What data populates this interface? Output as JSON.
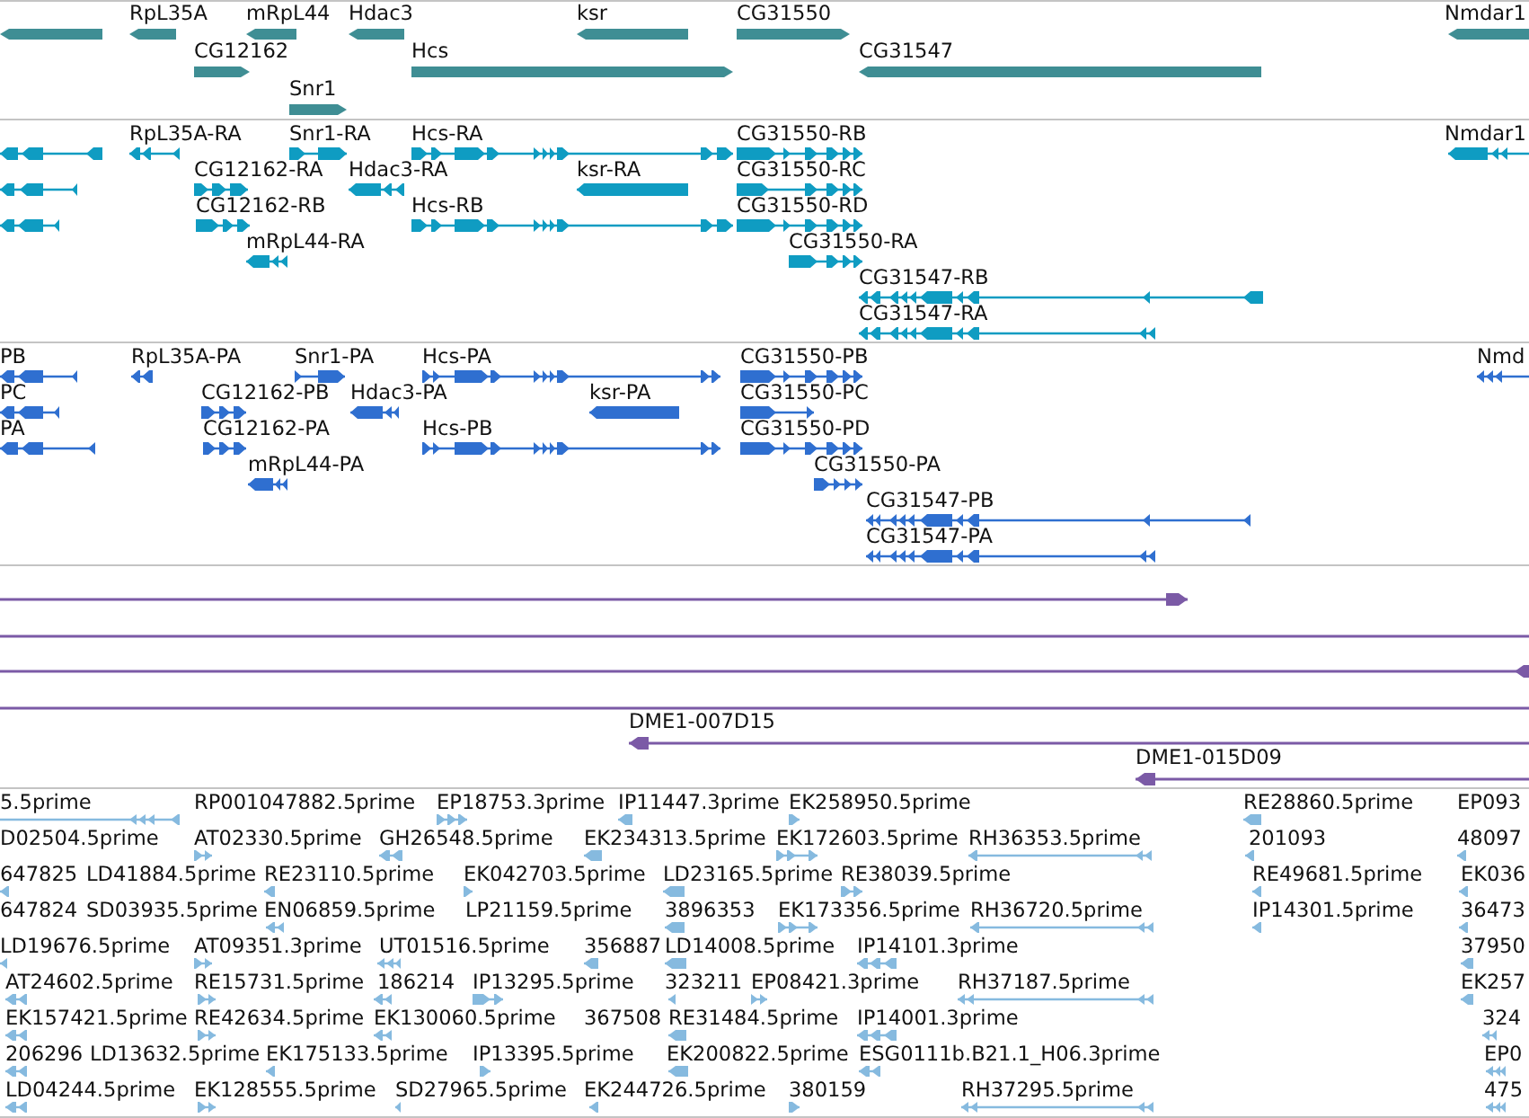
{
  "tracks": [
    {
      "kind": "gene",
      "color": "#3f8e94",
      "lanes": [
        {
          "features": [
            {
              "reverse": true
            },
            {
              "label": "RpL35A",
              "reverse": true
            },
            {
              "label": "mRpL44",
              "reverse": true
            },
            {
              "label": "Hdac3",
              "reverse": true
            },
            {
              "label": "ksr",
              "reverse": true
            },
            {
              "label": "CG31550",
              "reverse": false
            },
            {
              "label": "Nmdar1",
              "reverse": true
            }
          ]
        },
        {
          "features": [
            {
              "label": "CG12162",
              "reverse": false
            },
            {
              "label": "Hcs",
              "reverse": false
            },
            {
              "label": "CG31547",
              "reverse": true
            }
          ]
        },
        {
          "features": [
            {
              "label": "Snr1",
              "reverse": false
            }
          ]
        }
      ]
    },
    {
      "kind": "transcript",
      "color": "#0f9cc2",
      "lanes": [
        {
          "features": [
            {
              "reverse": true
            },
            {
              "label": "RpL35A-RA",
              "reverse": true
            },
            {
              "label": "Snr1-RA",
              "reverse": false
            },
            {
              "label": "Hcs-RA",
              "reverse": false
            },
            {
              "label": "CG31550-RB",
              "reverse": false
            },
            {
              "label": "Nmdar1",
              "reverse": true
            }
          ]
        },
        {
          "features": [
            {
              "reverse": true
            },
            {
              "label": "CG12162-RA",
              "reverse": false
            },
            {
              "label": "Hdac3-RA",
              "reverse": true
            },
            {
              "label": "ksr-RA",
              "reverse": true
            },
            {
              "label": "CG31550-RC",
              "reverse": false
            }
          ]
        },
        {
          "features": [
            {
              "reverse": true
            },
            {
              "label": "CG12162-RB",
              "reverse": false
            },
            {
              "label": "Hcs-RB",
              "reverse": false
            },
            {
              "label": "CG31550-RD",
              "reverse": false
            }
          ]
        },
        {
          "features": [
            {
              "label": "mRpL44-RA",
              "reverse": true
            },
            {
              "label": "CG31550-RA",
              "reverse": false
            }
          ]
        },
        {
          "features": [
            {
              "label": "CG31547-RB",
              "reverse": true
            }
          ]
        },
        {
          "features": [
            {
              "label": "CG31547-RA",
              "reverse": true
            }
          ]
        }
      ]
    },
    {
      "kind": "protein",
      "color": "#2f6fd0",
      "lanes": [
        {
          "features": [
            {
              "label": "PB",
              "reverse": true
            },
            {
              "label": "RpL35A-PA",
              "reverse": true
            },
            {
              "label": "Snr1-PA",
              "reverse": false
            },
            {
              "label": "Hcs-PA",
              "reverse": false
            },
            {
              "label": "CG31550-PB",
              "reverse": false
            },
            {
              "label": "Nmd",
              "reverse": true
            }
          ]
        },
        {
          "features": [
            {
              "label": "PC",
              "reverse": true
            },
            {
              "label": "CG12162-PB",
              "reverse": false
            },
            {
              "label": "Hdac3-PA",
              "reverse": true
            },
            {
              "label": "ksr-PA",
              "reverse": true
            },
            {
              "label": "CG31550-PC",
              "reverse": false
            }
          ]
        },
        {
          "features": [
            {
              "label": "PA",
              "reverse": true
            },
            {
              "label": "CG12162-PA",
              "reverse": false
            },
            {
              "label": "Hcs-PB",
              "reverse": false
            },
            {
              "label": "CG31550-PD",
              "reverse": false
            }
          ]
        },
        {
          "features": [
            {
              "label": "mRpL44-PA",
              "reverse": true
            },
            {
              "label": "CG31550-PA",
              "reverse": false
            }
          ]
        },
        {
          "features": [
            {
              "label": "CG31547-PB",
              "reverse": true
            }
          ]
        },
        {
          "features": [
            {
              "label": "CG31547-PA",
              "reverse": true
            }
          ]
        }
      ]
    },
    {
      "kind": "clone",
      "color": "#7b5aa6",
      "lanes": [
        {
          "features": [
            {
              "kind": "arrow",
              "reverse": false
            }
          ]
        },
        {
          "features": [
            {
              "kind": "line"
            }
          ]
        },
        {
          "features": [
            {
              "kind": "arrow",
              "reverse": true
            }
          ]
        },
        {
          "features": [
            {
              "kind": "line"
            }
          ]
        },
        {
          "features": [
            {
              "kind": "arrow",
              "label": "DME1-007D15",
              "reverse": true
            }
          ]
        },
        {
          "features": [
            {
              "kind": "arrow",
              "label": "DME1-015D09",
              "reverse": true
            }
          ]
        }
      ]
    },
    {
      "kind": "est",
      "color": "#86badf",
      "lanes": [
        {
          "features": [
            {
              "label": "5.5prime",
              "reverse": true
            },
            {
              "label": "RP001047882.5prime"
            },
            {
              "label": "EP18753.3prime",
              "reverse": false
            },
            {
              "label": "IP11447.3prime",
              "reverse": true
            },
            {
              "label": "EK258950.5prime",
              "reverse": false
            },
            {
              "label": "RE28860.5prime",
              "reverse": true
            },
            {
              "label": "EP093"
            }
          ]
        },
        {
          "features": [
            {
              "label": "D02504.5prime"
            },
            {
              "label": "AT02330.5prime",
              "reverse": false
            },
            {
              "label": "GH26548.5prime",
              "reverse": true
            },
            {
              "label": "EK234313.5prime",
              "reverse": true
            },
            {
              "label": "EK172603.5prime",
              "reverse": false
            },
            {
              "label": "RH36353.5prime",
              "reverse": true
            },
            {
              "label": "201093",
              "reverse": true
            },
            {
              "label": "48097",
              "reverse": true
            }
          ]
        },
        {
          "features": [
            {
              "label": "647825",
              "reverse": true
            },
            {
              "label": "LD41884.5prime"
            },
            {
              "label": "RE23110.5prime",
              "reverse": true
            },
            {
              "label": "EK042703.5prime",
              "reverse": false
            },
            {
              "label": "LD23165.5prime",
              "reverse": true
            },
            {
              "label": "RE38039.5prime",
              "reverse": false
            },
            {
              "label": "RE49681.5prime",
              "reverse": true
            },
            {
              "label": "EK036",
              "reverse": true
            }
          ]
        },
        {
          "features": [
            {
              "label": "647824"
            },
            {
              "label": "SD03935.5prime"
            },
            {
              "label": "EN06859.5prime",
              "reverse": true
            },
            {
              "label": "LP21159.5prime"
            },
            {
              "label": "3896353",
              "reverse": true
            },
            {
              "label": "EK173356.5prime",
              "reverse": false
            },
            {
              "label": "RH36720.5prime",
              "reverse": true
            },
            {
              "label": "IP14301.5prime",
              "reverse": true
            },
            {
              "label": "36473",
              "reverse": true
            }
          ]
        },
        {
          "features": [
            {
              "label": "LD19676.5prime",
              "reverse": true
            },
            {
              "label": "AT09351.3prime",
              "reverse": false
            },
            {
              "label": "UT01516.5prime",
              "reverse": true
            },
            {
              "label": "356887",
              "reverse": true
            },
            {
              "label": "LD14008.5prime",
              "reverse": true
            },
            {
              "label": "IP14101.3prime",
              "reverse": true
            },
            {
              "label": "37950",
              "reverse": true
            }
          ]
        },
        {
          "features": [
            {
              "label": "AT24602.5prime",
              "reverse": true
            },
            {
              "label": "RE15731.5prime",
              "reverse": false
            },
            {
              "label": "186214",
              "reverse": true
            },
            {
              "label": "IP13295.5prime",
              "reverse": false
            },
            {
              "label": "323211",
              "reverse": true
            },
            {
              "label": "EP08421.3prime",
              "reverse": false
            },
            {
              "label": "RH37187.5prime",
              "reverse": true
            },
            {
              "label": "EK257",
              "reverse": true
            }
          ]
        },
        {
          "features": [
            {
              "label": "EK157421.5prime",
              "reverse": true
            },
            {
              "label": "RE42634.5prime",
              "reverse": false
            },
            {
              "label": "EK130060.5prime",
              "reverse": true
            },
            {
              "label": "367508"
            },
            {
              "label": "RE31484.5prime",
              "reverse": true
            },
            {
              "label": "IP14001.3prime",
              "reverse": true
            },
            {
              "label": "324",
              "reverse": true
            }
          ]
        },
        {
          "features": [
            {
              "label": "206296",
              "reverse": true
            },
            {
              "label": "LD13632.5prime"
            },
            {
              "label": "EK175133.5prime",
              "reverse": true
            },
            {
              "label": "IP13395.5prime",
              "reverse": false
            },
            {
              "label": "EK200822.5prime",
              "reverse": true
            },
            {
              "label": "ESG0111b.B21.1_H06.3prime",
              "reverse": true
            },
            {
              "label": "EP0",
              "reverse": true
            }
          ]
        },
        {
          "features": [
            {
              "label": "LD04244.5prime",
              "reverse": true
            },
            {
              "label": "EK128555.5prime",
              "reverse": false
            },
            {
              "label": "SD27965.5prime",
              "reverse": true
            },
            {
              "label": "EK244726.5prime",
              "reverse": true
            },
            {
              "label": "380159",
              "reverse": false
            },
            {
              "label": "RH37295.5prime",
              "reverse": true
            },
            {
              "label": "475",
              "reverse": true
            }
          ]
        }
      ]
    }
  ]
}
